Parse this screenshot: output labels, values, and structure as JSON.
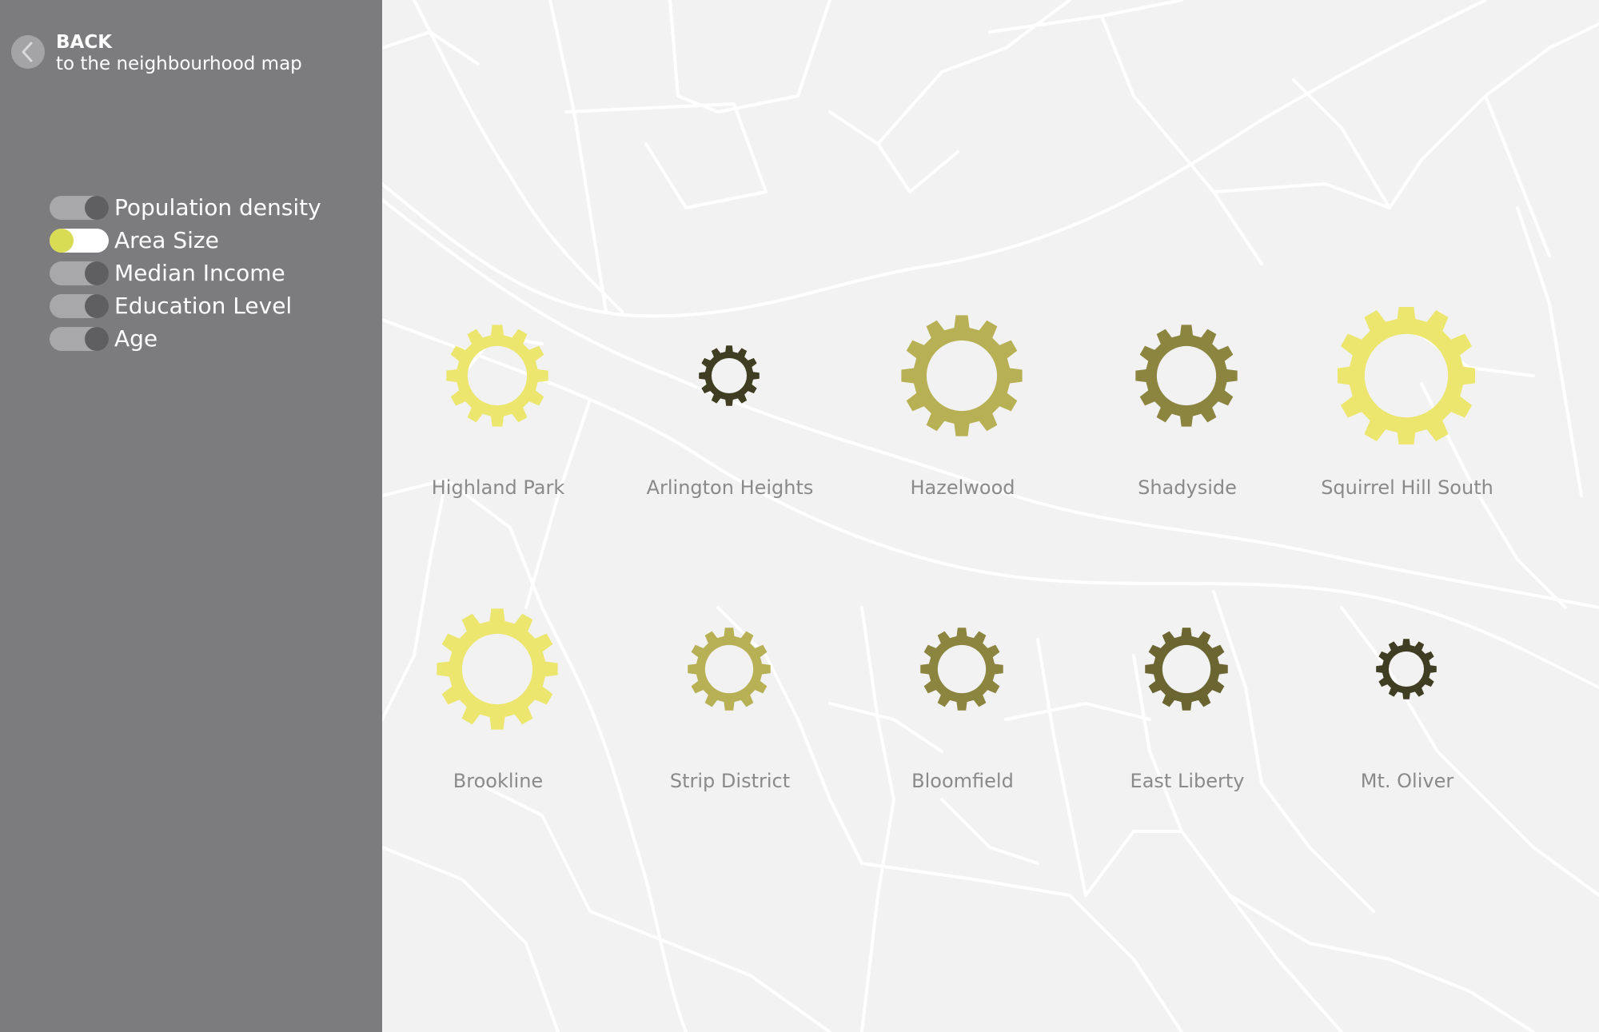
{
  "back": {
    "title": "BACK",
    "subtitle": "to the neighbourhood map",
    "icon": "chevron-left-icon"
  },
  "toggles": [
    {
      "label": "Population density",
      "on": false
    },
    {
      "label": "Area Size",
      "on": true
    },
    {
      "label": "Median Income",
      "on": false
    },
    {
      "label": "Education Level",
      "on": false
    },
    {
      "label": "Age",
      "on": false
    }
  ],
  "colors": {
    "sidebar": "#7c7c7e",
    "map_background": "#f1f2f1",
    "toggle_active": "#d8dc55",
    "gear_shades": [
      "#ece66e",
      "#b8b054",
      "#8c8540",
      "#6a6531",
      "#3f3d22"
    ]
  },
  "neighbourhoods": [
    {
      "name": "Highland Park",
      "color": "#ece66e"
    },
    {
      "name": "Arlington Heights",
      "color": "#3f3d22"
    },
    {
      "name": "Hazelwood",
      "color": "#b8b054"
    },
    {
      "name": "Shadyside",
      "color": "#8c8540"
    },
    {
      "name": "Squirrel Hill South",
      "color": "#ece66e"
    },
    {
      "name": "Brookline",
      "color": "#ece66e"
    },
    {
      "name": "Strip District",
      "color": "#b8b054"
    },
    {
      "name": "Bloomfield",
      "color": "#8c8540"
    },
    {
      "name": "East Liberty",
      "color": "#6a6531"
    },
    {
      "name": "Mt. Oliver",
      "color": "#3f3d22"
    }
  ]
}
